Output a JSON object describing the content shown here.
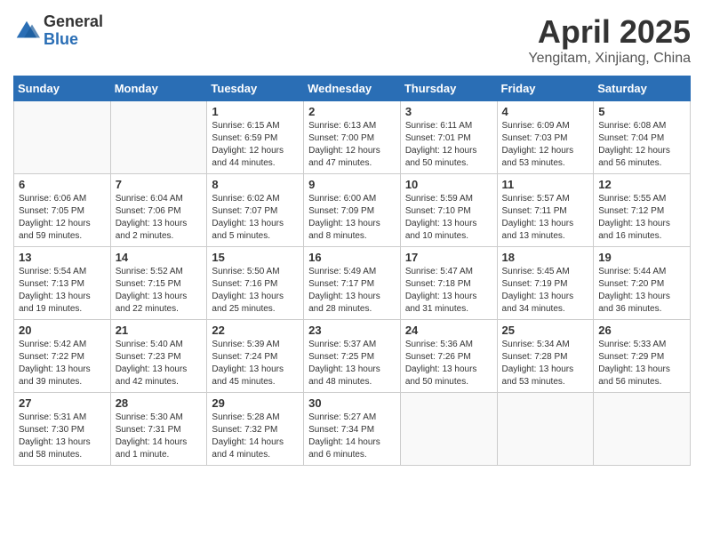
{
  "logo": {
    "general": "General",
    "blue": "Blue"
  },
  "header": {
    "month": "April 2025",
    "location": "Yengitam, Xinjiang, China"
  },
  "weekdays": [
    "Sunday",
    "Monday",
    "Tuesday",
    "Wednesday",
    "Thursday",
    "Friday",
    "Saturday"
  ],
  "weeks": [
    [
      {
        "day": "",
        "info": ""
      },
      {
        "day": "",
        "info": ""
      },
      {
        "day": "1",
        "info": "Sunrise: 6:15 AM\nSunset: 6:59 PM\nDaylight: 12 hours\nand 44 minutes."
      },
      {
        "day": "2",
        "info": "Sunrise: 6:13 AM\nSunset: 7:00 PM\nDaylight: 12 hours\nand 47 minutes."
      },
      {
        "day": "3",
        "info": "Sunrise: 6:11 AM\nSunset: 7:01 PM\nDaylight: 12 hours\nand 50 minutes."
      },
      {
        "day": "4",
        "info": "Sunrise: 6:09 AM\nSunset: 7:03 PM\nDaylight: 12 hours\nand 53 minutes."
      },
      {
        "day": "5",
        "info": "Sunrise: 6:08 AM\nSunset: 7:04 PM\nDaylight: 12 hours\nand 56 minutes."
      }
    ],
    [
      {
        "day": "6",
        "info": "Sunrise: 6:06 AM\nSunset: 7:05 PM\nDaylight: 12 hours\nand 59 minutes."
      },
      {
        "day": "7",
        "info": "Sunrise: 6:04 AM\nSunset: 7:06 PM\nDaylight: 13 hours\nand 2 minutes."
      },
      {
        "day": "8",
        "info": "Sunrise: 6:02 AM\nSunset: 7:07 PM\nDaylight: 13 hours\nand 5 minutes."
      },
      {
        "day": "9",
        "info": "Sunrise: 6:00 AM\nSunset: 7:09 PM\nDaylight: 13 hours\nand 8 minutes."
      },
      {
        "day": "10",
        "info": "Sunrise: 5:59 AM\nSunset: 7:10 PM\nDaylight: 13 hours\nand 10 minutes."
      },
      {
        "day": "11",
        "info": "Sunrise: 5:57 AM\nSunset: 7:11 PM\nDaylight: 13 hours\nand 13 minutes."
      },
      {
        "day": "12",
        "info": "Sunrise: 5:55 AM\nSunset: 7:12 PM\nDaylight: 13 hours\nand 16 minutes."
      }
    ],
    [
      {
        "day": "13",
        "info": "Sunrise: 5:54 AM\nSunset: 7:13 PM\nDaylight: 13 hours\nand 19 minutes."
      },
      {
        "day": "14",
        "info": "Sunrise: 5:52 AM\nSunset: 7:15 PM\nDaylight: 13 hours\nand 22 minutes."
      },
      {
        "day": "15",
        "info": "Sunrise: 5:50 AM\nSunset: 7:16 PM\nDaylight: 13 hours\nand 25 minutes."
      },
      {
        "day": "16",
        "info": "Sunrise: 5:49 AM\nSunset: 7:17 PM\nDaylight: 13 hours\nand 28 minutes."
      },
      {
        "day": "17",
        "info": "Sunrise: 5:47 AM\nSunset: 7:18 PM\nDaylight: 13 hours\nand 31 minutes."
      },
      {
        "day": "18",
        "info": "Sunrise: 5:45 AM\nSunset: 7:19 PM\nDaylight: 13 hours\nand 34 minutes."
      },
      {
        "day": "19",
        "info": "Sunrise: 5:44 AM\nSunset: 7:20 PM\nDaylight: 13 hours\nand 36 minutes."
      }
    ],
    [
      {
        "day": "20",
        "info": "Sunrise: 5:42 AM\nSunset: 7:22 PM\nDaylight: 13 hours\nand 39 minutes."
      },
      {
        "day": "21",
        "info": "Sunrise: 5:40 AM\nSunset: 7:23 PM\nDaylight: 13 hours\nand 42 minutes."
      },
      {
        "day": "22",
        "info": "Sunrise: 5:39 AM\nSunset: 7:24 PM\nDaylight: 13 hours\nand 45 minutes."
      },
      {
        "day": "23",
        "info": "Sunrise: 5:37 AM\nSunset: 7:25 PM\nDaylight: 13 hours\nand 48 minutes."
      },
      {
        "day": "24",
        "info": "Sunrise: 5:36 AM\nSunset: 7:26 PM\nDaylight: 13 hours\nand 50 minutes."
      },
      {
        "day": "25",
        "info": "Sunrise: 5:34 AM\nSunset: 7:28 PM\nDaylight: 13 hours\nand 53 minutes."
      },
      {
        "day": "26",
        "info": "Sunrise: 5:33 AM\nSunset: 7:29 PM\nDaylight: 13 hours\nand 56 minutes."
      }
    ],
    [
      {
        "day": "27",
        "info": "Sunrise: 5:31 AM\nSunset: 7:30 PM\nDaylight: 13 hours\nand 58 minutes."
      },
      {
        "day": "28",
        "info": "Sunrise: 5:30 AM\nSunset: 7:31 PM\nDaylight: 14 hours\nand 1 minute."
      },
      {
        "day": "29",
        "info": "Sunrise: 5:28 AM\nSunset: 7:32 PM\nDaylight: 14 hours\nand 4 minutes."
      },
      {
        "day": "30",
        "info": "Sunrise: 5:27 AM\nSunset: 7:34 PM\nDaylight: 14 hours\nand 6 minutes."
      },
      {
        "day": "",
        "info": ""
      },
      {
        "day": "",
        "info": ""
      },
      {
        "day": "",
        "info": ""
      }
    ]
  ]
}
